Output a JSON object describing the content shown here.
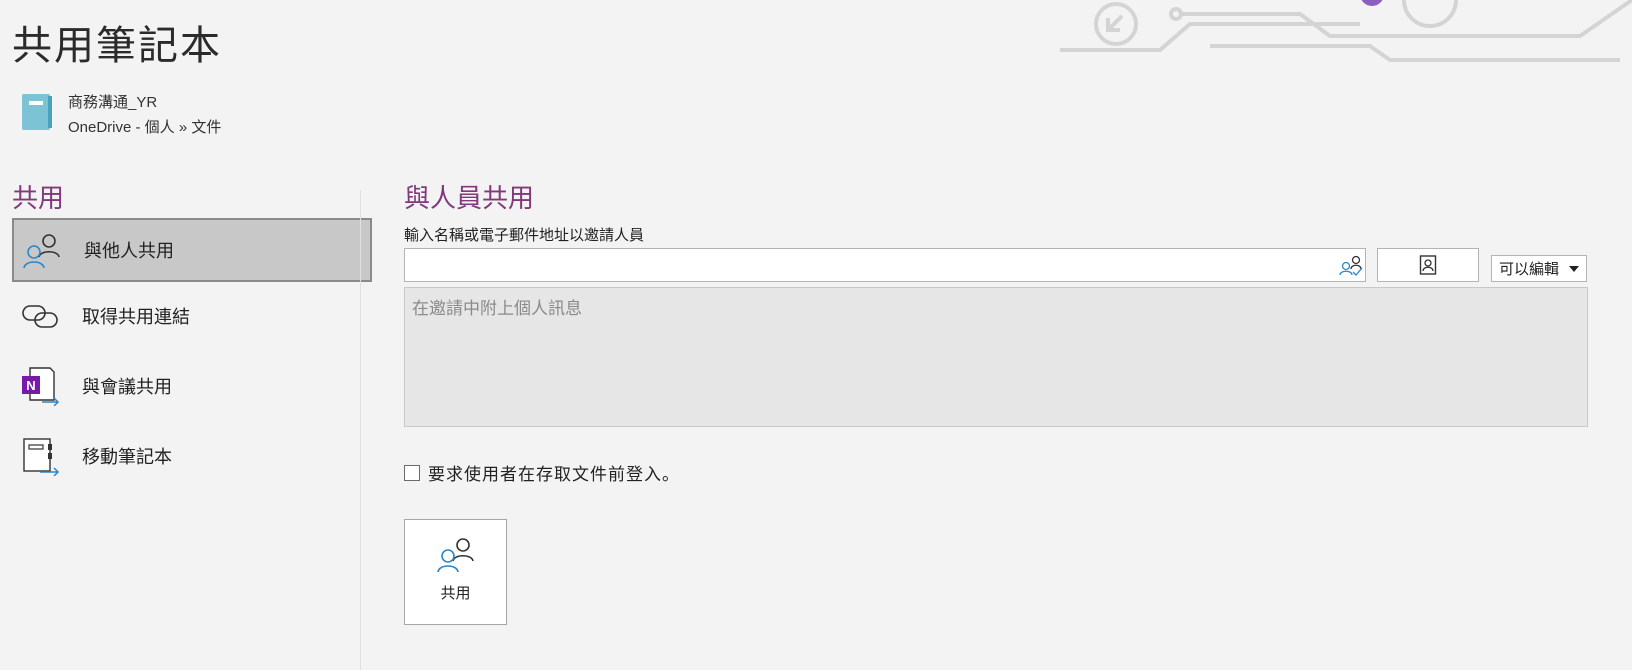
{
  "page": {
    "title": "共用筆記本"
  },
  "notebook": {
    "name": "商務溝通_YR",
    "location": "OneDrive - 個人 » 文件"
  },
  "sidebar": {
    "heading": "共用",
    "items": [
      {
        "label": "與他人共用",
        "icon": "people-share-icon",
        "active": true
      },
      {
        "label": "取得共用連結",
        "icon": "link-icon",
        "active": false
      },
      {
        "label": "與會議共用",
        "icon": "onenote-meeting-icon",
        "active": false
      },
      {
        "label": "移動筆記本",
        "icon": "move-notebook-icon",
        "active": false
      }
    ]
  },
  "main": {
    "heading": "與人員共用",
    "invite_label": "輸入名稱或電子郵件地址以邀請人員",
    "invite_value": "",
    "permission": "可以編輯",
    "message_placeholder": "在邀請中附上個人訊息",
    "require_signin_label": "要求使用者在存取文件前登入。",
    "require_signin_checked": false,
    "share_button_label": "共用"
  },
  "colors": {
    "accent": "#80397b",
    "background": "#f3f3f3",
    "active_item": "#c8c8c8",
    "icon_blue": "#2a88c8"
  }
}
